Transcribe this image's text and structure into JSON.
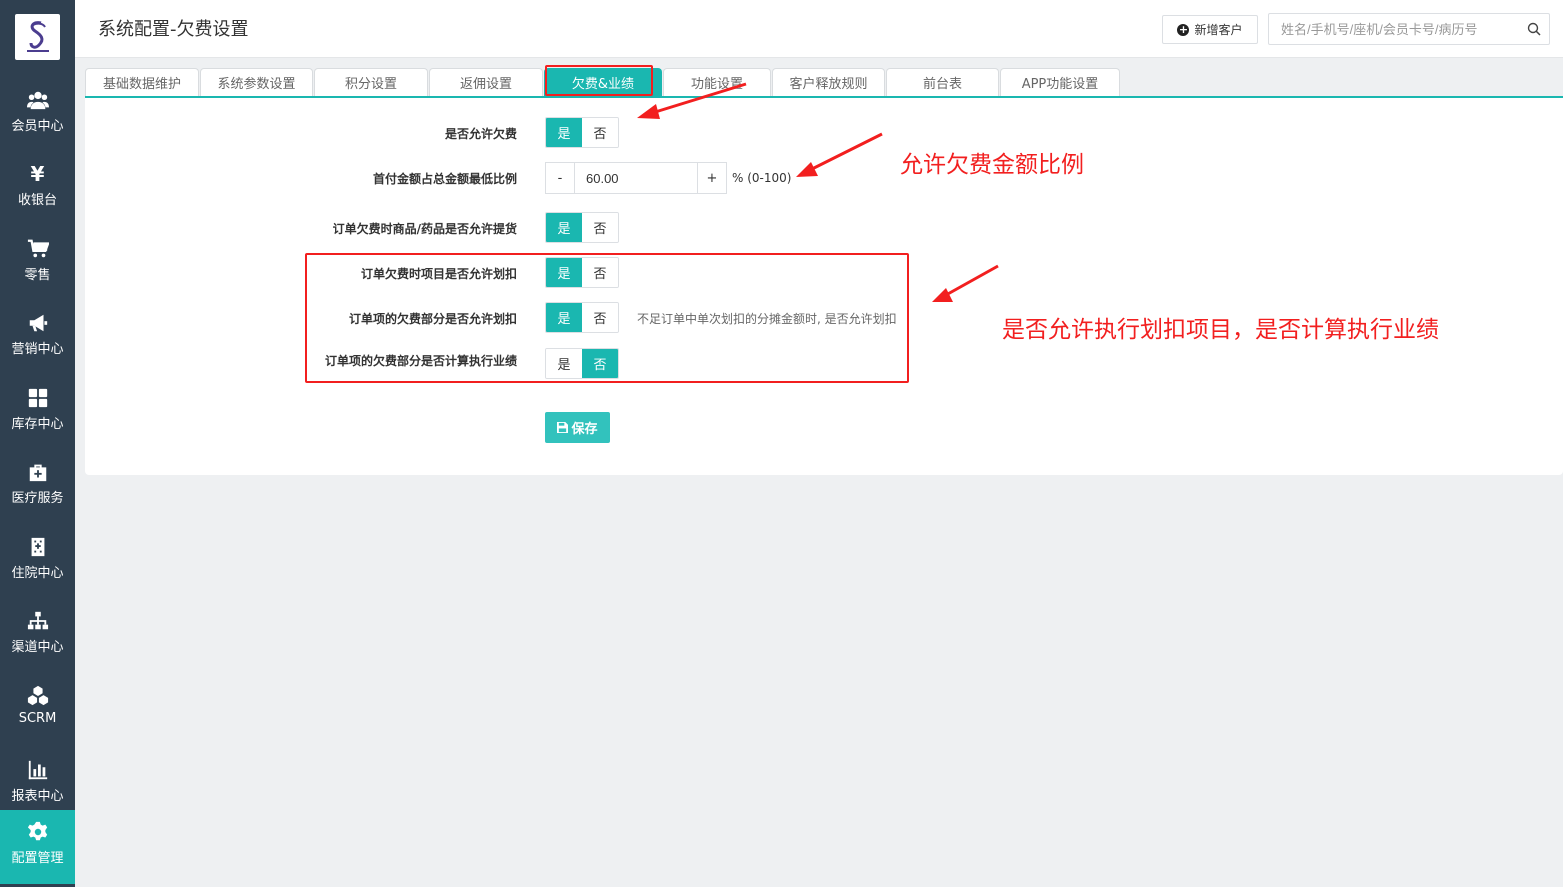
{
  "sidebar": {
    "items": [
      {
        "label": "会员中心",
        "icon": "users-icon"
      },
      {
        "label": "收银台",
        "icon": "yen-icon"
      },
      {
        "label": "零售",
        "icon": "cart-icon"
      },
      {
        "label": "营销中心",
        "icon": "megaphone-icon"
      },
      {
        "label": "库存中心",
        "icon": "grid-icon"
      },
      {
        "label": "医疗服务",
        "icon": "medkit-icon"
      },
      {
        "label": "住院中心",
        "icon": "hospital-icon"
      },
      {
        "label": "渠道中心",
        "icon": "sitemap-icon"
      },
      {
        "label": "SCRM",
        "icon": "cubes-icon"
      },
      {
        "label": "报表中心",
        "icon": "bar-chart-icon"
      },
      {
        "label": "配置管理",
        "icon": "gear-icon",
        "active": true
      }
    ]
  },
  "header": {
    "title": "系统配置-欠费设置",
    "add_customer": "新增客户",
    "search_placeholder": "姓名/手机号/座机/会员卡号/病历号"
  },
  "tabs": [
    {
      "label": "基础数据维护"
    },
    {
      "label": "系统参数设置"
    },
    {
      "label": "积分设置"
    },
    {
      "label": "返佣设置"
    },
    {
      "label": "欠费&业绩",
      "active": true
    },
    {
      "label": "功能设置"
    },
    {
      "label": "客户释放规则"
    },
    {
      "label": "前台表"
    },
    {
      "label": "APP功能设置"
    }
  ],
  "form": {
    "yes": "是",
    "no": "否",
    "allow_arrears": {
      "label": "是否允许欠费",
      "value": "是"
    },
    "min_ratio": {
      "label": "首付金额占总金额最低比例",
      "minus": "-",
      "plus": "+",
      "value": "60.00",
      "suffix": "% (0-100)"
    },
    "allow_pickup": {
      "label": "订单欠费时商品/药品是否允许提货",
      "value": "是"
    },
    "allow_deduct_items": {
      "label": "订单欠费时项目是否允许划扣",
      "value": "是"
    },
    "allow_deduct_partial": {
      "label": "订单项的欠费部分是否允许划扣",
      "value": "是",
      "hint": "不足订单中单次划扣的分摊金额时, 是否允许划扣"
    },
    "count_performance": {
      "label": "订单项的欠费部分是否计算执行业绩",
      "value": "否"
    },
    "save": "保存"
  },
  "annotations": {
    "note1": "允许欠费金额比例",
    "note2": "是否允许执行划扣项目，是否计算执行业绩",
    "color": "#f21f1f"
  },
  "colors": {
    "accent": "#1ab7b0",
    "sidebar": "#2f4050"
  }
}
